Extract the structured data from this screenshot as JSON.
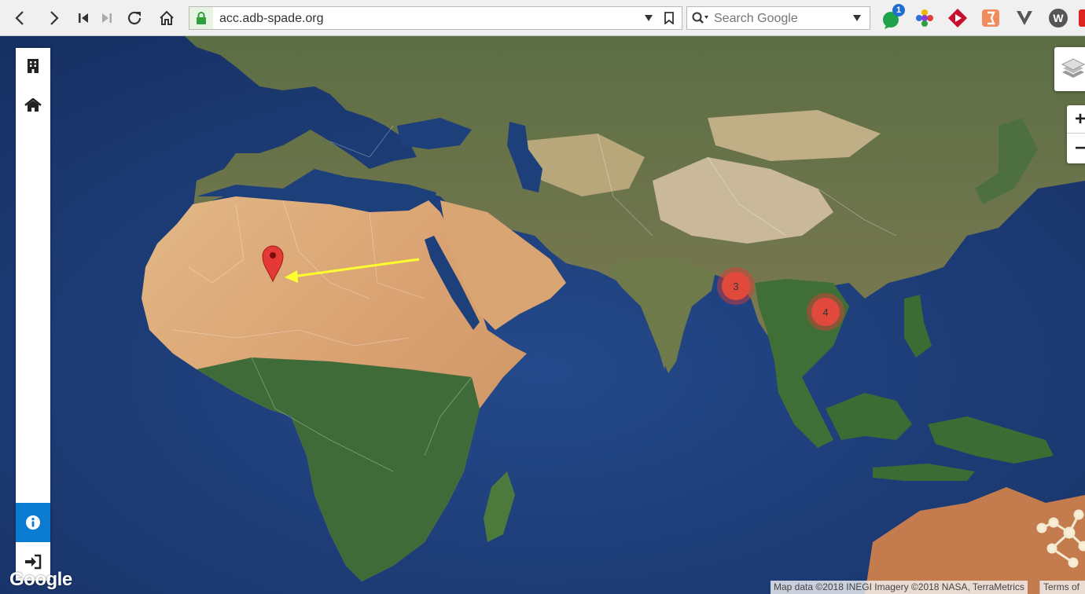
{
  "browser": {
    "url": "acc.adb-spade.org",
    "search_placeholder": "Search Google",
    "notification_badge": "1"
  },
  "map": {
    "clusters": [
      {
        "label": "3",
        "count": 3
      },
      {
        "label": "4",
        "count": 4
      }
    ],
    "marker_color": "#e53935",
    "annotation_arrow_color": "#ffff2e",
    "attribution": "Map data ©2018 INEGI Imagery ©2018 NASA, TerraMetrics",
    "terms": "Terms of",
    "logo": "Google"
  },
  "controls": {
    "zoom_in": "+",
    "zoom_out": "−"
  },
  "sidebar": {
    "items": [
      {
        "icon": "building-icon"
      },
      {
        "icon": "home-icon"
      },
      {
        "icon": "info-icon"
      },
      {
        "icon": "sign-in-icon"
      }
    ],
    "active_color": "#0b7ad1"
  }
}
